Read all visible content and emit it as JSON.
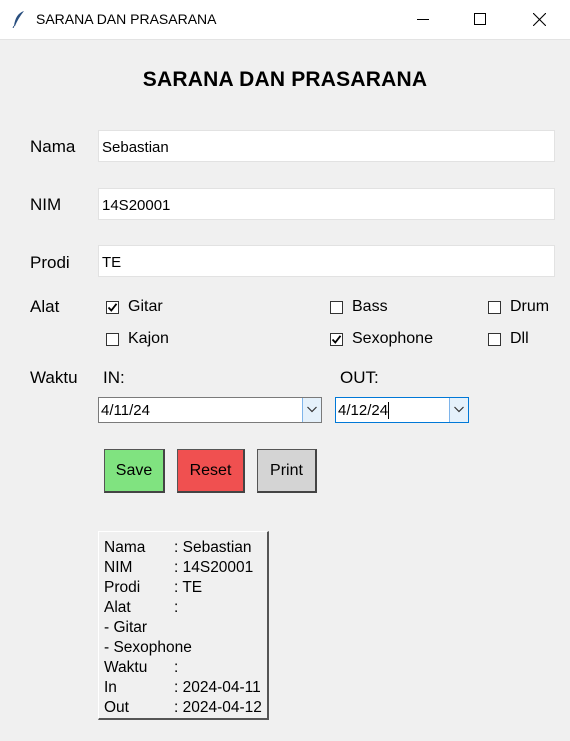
{
  "window": {
    "title": "SARANA DAN PRASARANA"
  },
  "form": {
    "heading": "SARANA DAN PRASARANA",
    "nama_label": "Nama",
    "nama_value": "Sebastian",
    "nim_label": "NIM",
    "nim_value": "14S20001",
    "prodi_label": "Prodi",
    "prodi_value": "TE",
    "alat_label": "Alat",
    "alat": [
      {
        "label": "Gitar",
        "checked": true
      },
      {
        "label": "Bass",
        "checked": false
      },
      {
        "label": "Drum",
        "checked": false
      },
      {
        "label": "Kajon",
        "checked": false
      },
      {
        "label": "Sexophone",
        "checked": true
      },
      {
        "label": "Dll",
        "checked": false
      }
    ],
    "waktu_label": "Waktu",
    "in_label": "IN:",
    "out_label": "OUT:",
    "in_value": "4/11/24",
    "out_value": "4/12/24"
  },
  "buttons": {
    "save": {
      "label": "Save",
      "color": "#80e380"
    },
    "reset": {
      "label": "Reset",
      "color": "#f05050"
    },
    "print": {
      "label": "Print",
      "color": "#d4d4d4"
    }
  },
  "output": {
    "lines": [
      {
        "key": "Nama",
        "value": ": Sebastian"
      },
      {
        "key": "NIM",
        "value": ": 14S20001"
      },
      {
        "key": "Prodi",
        "value": ": TE"
      },
      {
        "key": "Alat",
        "value": ":"
      },
      {
        "key": "- Gitar",
        "value": ""
      },
      {
        "key": "- Sexophone",
        "value": ""
      },
      {
        "key": "Waktu",
        "value": ":"
      },
      {
        "key": "In",
        "value": ": 2024-04-11"
      },
      {
        "key": "Out",
        "value": ": 2024-04-12"
      }
    ]
  }
}
